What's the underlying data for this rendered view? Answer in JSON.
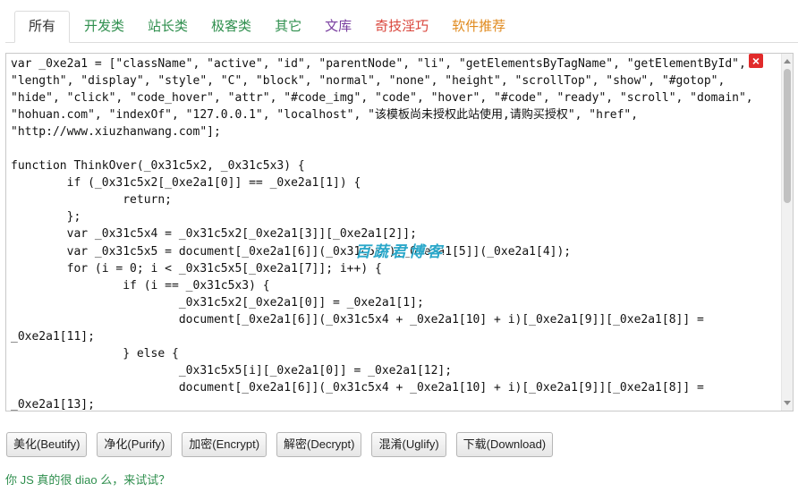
{
  "tabs": [
    {
      "label": "所有",
      "color": "#333333"
    },
    {
      "label": "开发类",
      "color": "#2f8f4e"
    },
    {
      "label": "站长类",
      "color": "#2f8f4e"
    },
    {
      "label": "极客类",
      "color": "#2f8f4e"
    },
    {
      "label": "其它",
      "color": "#2f8f4e"
    },
    {
      "label": "文库",
      "color": "#7a3fa0"
    },
    {
      "label": "奇技淫巧",
      "color": "#d9443a"
    },
    {
      "label": "软件推荐",
      "color": "#e08a1e"
    }
  ],
  "editor": {
    "close_icon": "×",
    "watermark": "百蔬君博客",
    "code_lines": [
      "var _0xe2a1 = [\"className\", \"active\", \"id\", \"parentNode\", \"li\", \"getElementsByTagName\", \"getElementById\",",
      "\"length\", \"display\", \"style\", \"C\", \"block\", \"normal\", \"none\", \"height\", \"scrollTop\", \"show\", \"#gotop\",",
      "\"hide\", \"click\", \"code_hover\", \"attr\", \"#code_img\", \"code\", \"hover\", \"#code\", \"ready\", \"scroll\", \"domain\",",
      "\"hohuan.com\", \"indexOf\", \"127.0.0.1\", \"localhost\", \"该模板尚未授权此站使用,请购买授权\", \"href\",",
      "\"http://www.xiuzhanwang.com\"];",
      "",
      "function ThinkOver(_0x31c5x2, _0x31c5x3) {",
      "        if (_0x31c5x2[_0xe2a1[0]] == _0xe2a1[1]) {",
      "                return;",
      "        };",
      "        var _0x31c5x4 = _0x31c5x2[_0xe2a1[3]][_0xe2a1[2]];",
      "        var _0x31c5x5 = document[_0xe2a1[6]](_0x31c5x4)[_0xe2a1[5]](_0xe2a1[4]);",
      "        for (i = 0; i < _0x31c5x5[_0xe2a1[7]]; i++) {",
      "                if (i == _0x31c5x3) {",
      "                        _0x31c5x2[_0xe2a1[0]] = _0xe2a1[1];",
      "                        document[_0xe2a1[6]](_0x31c5x4 + _0xe2a1[10] + i)[_0xe2a1[9]][_0xe2a1[8]] =",
      "_0xe2a1[11];",
      "                } else {",
      "                        _0x31c5x5[i][_0xe2a1[0]] = _0xe2a1[12];",
      "                        document[_0xe2a1[6]](_0x31c5x4 + _0xe2a1[10] + i)[_0xe2a1[9]][_0xe2a1[8]] =",
      "_0xe2a1[13];"
    ]
  },
  "buttons": [
    {
      "label": "美化(Beutify)"
    },
    {
      "label": "净化(Purify)"
    },
    {
      "label": "加密(Encrypt)"
    },
    {
      "label": "解密(Decrypt)"
    },
    {
      "label": "混淆(Uglify)"
    },
    {
      "label": "下载(Download)"
    }
  ],
  "hint": "你 JS 真的很 diao 么，来试试？"
}
